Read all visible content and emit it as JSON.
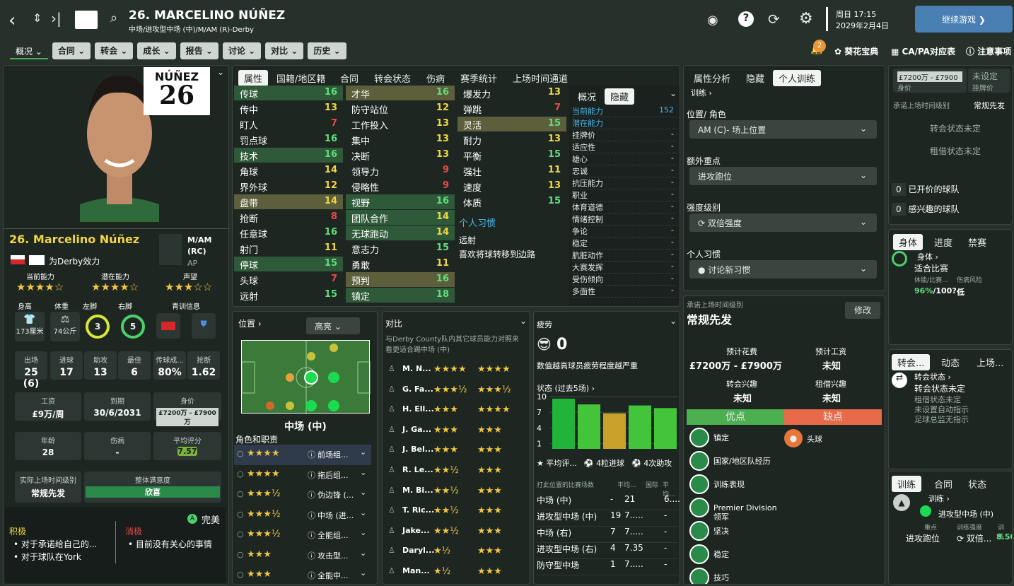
{
  "header": {
    "name": "26. MARCELINO NÚÑEZ",
    "subtitle": "中场/进攻型中场 (中)/M/AM (R)-Derby",
    "day": "周日 17:15",
    "date": "2029年2月4日",
    "continue": "继续游戏",
    "notif_count": "2"
  },
  "nav": [
    "概况",
    "合同",
    "转会",
    "成长",
    "报告",
    "讨论",
    "对比",
    "历史"
  ],
  "right_links": [
    "葵花宝典",
    "CA/PA对应表",
    "注意事项"
  ],
  "player": {
    "shirt_name": "NÚÑEZ",
    "shirt_num": "26",
    "title": "26. Marcelino Núñez",
    "club": "为Derby效力",
    "pos1": "M/AM",
    "pos2": "(RC)",
    "pos3": "AP",
    "labels": [
      "当前能力",
      "潜在能力",
      "声望"
    ],
    "stars": [
      "★★★★☆",
      "★★★★☆",
      "★★★☆☆"
    ],
    "phys_labels": [
      "身高",
      "体重",
      "左脚",
      "右脚",
      "青训信息"
    ],
    "height": "173厘米",
    "weight": "74公斤",
    "left_foot": "3",
    "right_foot": "5",
    "stats": [
      {
        "l": "出场",
        "v": "25 (6)"
      },
      {
        "l": "进球",
        "v": "17"
      },
      {
        "l": "助攻",
        "v": "13"
      },
      {
        "l": "最佳",
        "v": "6"
      },
      {
        "l": "传球成...",
        "v": "80%"
      },
      {
        "l": "抢断",
        "v": "1.62"
      }
    ],
    "wage_l": "工资",
    "wage": "£9万/周",
    "exp_l": "到期",
    "exp": "30/6/2031",
    "val_l": "身价",
    "val": "£7200万 - £7900万",
    "age_l": "年龄",
    "age": "28",
    "inj_l": "伤病",
    "inj": "-",
    "rating_l": "平均评分",
    "rating": "7.57",
    "playtime_l": "实际上场时间级别",
    "playtime": "常规先发",
    "morale_l": "整体满意度",
    "morale": "欣喜",
    "happy": "完美",
    "pos_l": "积极",
    "pos_items": [
      "对于承诺给自己的...",
      "对于球队在York"
    ],
    "neg_l": "消极",
    "neg_items": [
      "目前没有关心的事情"
    ]
  },
  "attr_tabs": [
    "属性",
    "国籍/地区籍",
    "合同",
    "转会状态",
    "伤病",
    "赛季统计",
    "上场时间通道"
  ],
  "tech": [
    [
      "传球",
      "16"
    ],
    [
      "传中",
      "13"
    ],
    [
      "盯人",
      "7"
    ],
    [
      "罚点球",
      "16"
    ],
    [
      "技术",
      "16"
    ],
    [
      "角球",
      "14"
    ],
    [
      "界外球",
      "12"
    ],
    [
      "盘带",
      "14"
    ],
    [
      "抢断",
      "8"
    ],
    [
      "任意球",
      "16"
    ],
    [
      "射门",
      "11"
    ],
    [
      "停球",
      "15"
    ],
    [
      "头球",
      "7"
    ],
    [
      "远射",
      "15"
    ]
  ],
  "ment": [
    [
      "才华",
      "16"
    ],
    [
      "防守站位",
      "12"
    ],
    [
      "工作投入",
      "13"
    ],
    [
      "集中",
      "13"
    ],
    [
      "决断",
      "13"
    ],
    [
      "领导力",
      "9"
    ],
    [
      "侵略性",
      "9"
    ],
    [
      "视野",
      "16"
    ],
    [
      "团队合作",
      "14"
    ],
    [
      "无球跑动",
      "14"
    ],
    [
      "意志力",
      "15"
    ],
    [
      "勇敢",
      "11"
    ],
    [
      "预判",
      "16"
    ],
    [
      "镇定",
      "18"
    ]
  ],
  "phys": [
    [
      "爆发力",
      "13"
    ],
    [
      "弹跳",
      "7"
    ],
    [
      "灵活",
      "15"
    ],
    [
      "耐力",
      "13"
    ],
    [
      "平衡",
      "15"
    ],
    [
      "强壮",
      "11"
    ],
    [
      "速度",
      "13"
    ],
    [
      "体质",
      "15"
    ]
  ],
  "habits_title": "个人习惯",
  "habits": [
    "远射",
    "喜欢将球转移到边路"
  ],
  "hidden": {
    "tabs": [
      "概况",
      "隐藏"
    ],
    "items": [
      [
        "当前能力",
        "152"
      ],
      [
        "潜在能力",
        ""
      ],
      [
        "挂牌价",
        "-"
      ],
      [
        "适应性",
        "-"
      ],
      [
        "雄心",
        "-"
      ],
      [
        "忠诚",
        "-"
      ],
      [
        "抗压能力",
        "-"
      ],
      [
        "职业",
        "-"
      ],
      [
        "体育道德",
        "-"
      ],
      [
        "情绪控制",
        "-"
      ],
      [
        "争论",
        "-"
      ],
      [
        "稳定",
        "-"
      ],
      [
        "肮脏动作",
        "-"
      ],
      [
        "大赛发挥",
        "-"
      ],
      [
        "受伤倾向",
        "-"
      ],
      [
        "多面性",
        "-"
      ]
    ]
  },
  "position": {
    "title": "位置",
    "sel": "高亮",
    "label": "中场 (中)",
    "roles_title": "角色和职责",
    "roles": [
      [
        "★★★★",
        "前场组..."
      ],
      [
        "★★★★",
        "拖后组..."
      ],
      [
        "★★★½",
        "伪边锋 (..."
      ],
      [
        "★★★½",
        "中场 (进..."
      ],
      [
        "★★★½",
        "全能组..."
      ],
      [
        "★★★",
        "攻击型..."
      ],
      [
        "★★★",
        "全能中..."
      ]
    ]
  },
  "compare": {
    "title": "对比",
    "desc": "与Derby County队内其它球员能力对照来看更适合踢中场 (中)",
    "rows": [
      [
        "M. N...",
        "★★★★",
        "★★★★"
      ],
      [
        "G. Fa...",
        "★★★½",
        "★★★½"
      ],
      [
        "H. Ell...",
        "★★★",
        "★★★★"
      ],
      [
        "J. Ga...",
        "★★★",
        "★★★"
      ],
      [
        "J. Bel...",
        "★★★",
        "★★★"
      ],
      [
        "R. Le...",
        "★★½",
        "★★★"
      ],
      [
        "M. Bi...",
        "★★½",
        "★★★"
      ],
      [
        "T. Ric...",
        "★★½",
        "★★★"
      ],
      [
        "Jake...",
        "★★½",
        "★★★"
      ],
      [
        "Daryl...",
        "★½",
        "★★★"
      ],
      [
        "Man...",
        "★½",
        "★★★"
      ]
    ]
  },
  "fatigue": {
    "title": "疲劳",
    "value": "0",
    "desc": "数值越高球员疲劳程度越严重",
    "form_title": "状态 (过去5场)",
    "form": [
      9.6,
      8.5,
      6.8,
      8.3,
      7.8
    ],
    "yticks": [
      "10",
      "7",
      "4",
      "1"
    ],
    "sum": [
      "平均评...",
      "4粒进球",
      "4次助攻"
    ],
    "table_head": [
      "打此位置的比赛场数",
      "平均...",
      "国际",
      "平均..."
    ],
    "table": [
      [
        "中场 (中)",
        "-",
        "21",
        "6...."
      ],
      [
        "进攻型中场 (中)",
        "19",
        "7.....",
        "-"
      ],
      [
        "中场 (右)",
        "7",
        "7.....",
        "-"
      ],
      [
        "进攻型中场 (右)",
        "4",
        "7.35",
        "-"
      ],
      [
        "防守型中场",
        "1",
        "7.....",
        "-"
      ]
    ]
  },
  "training": {
    "tabs": [
      "属性分析",
      "隐藏",
      "个人训练"
    ],
    "train": "训练",
    "pos_l": "位置/ 角色",
    "pos_v": "AM (C)- 场上位置",
    "extra_l": "额外重点",
    "extra_v": "进攻跑位",
    "int_l": "强度级别",
    "int_v": "双倍强度",
    "habit_l": "个人习惯",
    "habit_v": "讨论新习惯"
  },
  "promise": {
    "title": "承诺上场时间级别",
    "value": "常规先发",
    "edit": "修改",
    "fee_l": "预计花费",
    "fee": "£7200万 - £7900万",
    "wage_l": "预计工资",
    "wage": "未知",
    "tint_l": "转会兴趣",
    "tint": "未知",
    "loan_l": "租借兴趣",
    "loan": "未知",
    "pros": "优点",
    "cons": "缺点",
    "pro_items": [
      "镇定",
      "国家/地区队经历",
      "训练表现",
      "Premier Division领军",
      "坚决",
      "稳定",
      "技巧"
    ],
    "con_items": [
      "头球"
    ]
  },
  "side": {
    "value": "£7200万 - £7900",
    "value_l": "身价",
    "set": "未设定",
    "set_l": "挂牌价",
    "pt_l": "承诺上场时间级别",
    "pt": "常规先发",
    "ts": "转会状态未定",
    "ls": "租借状态未定",
    "offers": [
      [
        "0",
        "已开价的球队"
      ],
      [
        "0",
        "感兴趣的球队"
      ]
    ],
    "body_tabs": [
      "身体",
      "进度",
      "禁赛"
    ],
    "body": "身体",
    "fit": "适合比赛",
    "cond_l": "体能/比赛...",
    "inj_l": "伤病风险",
    "cond": "96%",
    "cond2": "/100?",
    "risk": "低",
    "tr_tabs": [
      "转会...",
      "动态",
      "上场..."
    ],
    "tr_title": "转会状态",
    "tr_lines": [
      "转会状态未定",
      "租借状态未定",
      "未设置自动指示",
      "足球总监无指示"
    ],
    "t_tabs": [
      "训练",
      "合同",
      "状态"
    ],
    "t_title": "训练",
    "t_role": "进攻型中场 (中)",
    "t_focus_l": "重点",
    "t_int_l": "训练强度",
    "t_last": "训练...",
    "t_focus": "进攻跑位",
    "t_int": "双倍...",
    "t_val": "8.50"
  }
}
